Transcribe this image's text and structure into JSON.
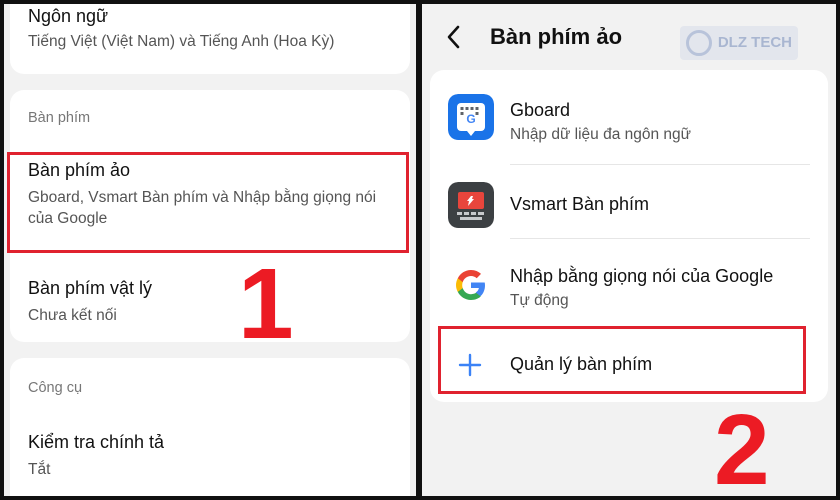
{
  "left": {
    "language": {
      "title": "Ngôn ngữ",
      "subtitle": "Tiếng Việt (Việt Nam) và Tiếng Anh (Hoa Kỳ)"
    },
    "keyboard_section_label": "Bàn phím",
    "virtual_keyboard": {
      "title": "Bàn phím ảo",
      "subtitle_line1": "Gboard, Vsmart Bàn phím và Nhập bằng giọng nói",
      "subtitle_line2": "của Google"
    },
    "physical_keyboard": {
      "title": "Bàn phím vật lý",
      "subtitle": "Chưa kết nối"
    },
    "tools_section_label": "Công cụ",
    "spell_check": {
      "title": "Kiểm tra chính tả",
      "subtitle": "Tắt"
    },
    "step_number": "1"
  },
  "right": {
    "header_title": "Bàn phím ảo",
    "watermark_text": "DLZ TECH",
    "keyboards": [
      {
        "title": "Gboard",
        "subtitle": "Nhập dữ liệu đa ngôn ngữ",
        "icon": "gboard-icon"
      },
      {
        "title": "Vsmart Bàn phím",
        "subtitle": "",
        "icon": "vsmart-keyboard-icon"
      },
      {
        "title": "Nhập bằng giọng nói của Google",
        "subtitle": "Tự động",
        "icon": "google-g-icon"
      }
    ],
    "manage_keyboards_label": "Quản lý bàn phím",
    "step_number": "2"
  },
  "colors": {
    "highlight": "#e0222f",
    "step_number": "#ec1b24",
    "accent": "#3b82f6"
  }
}
